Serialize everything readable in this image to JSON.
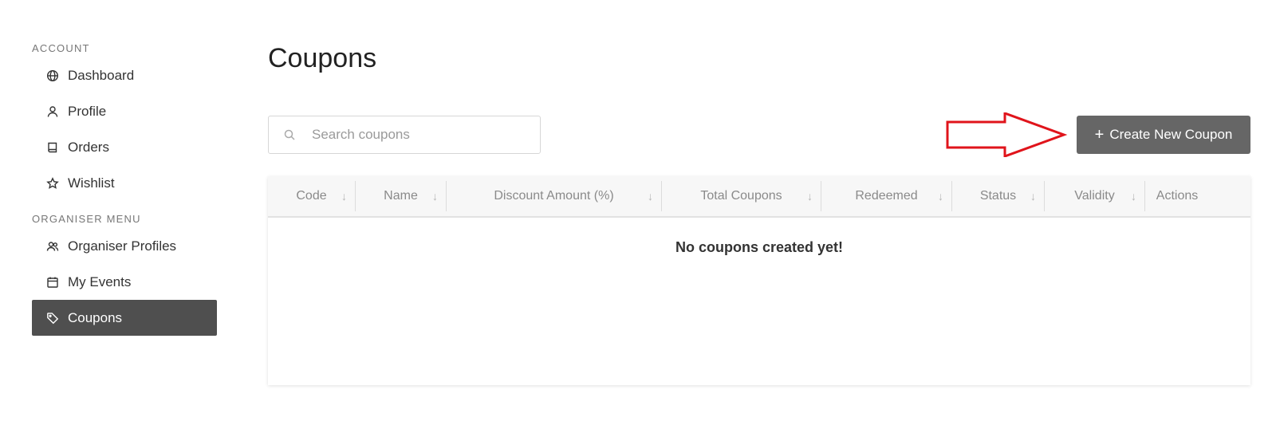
{
  "sidebar": {
    "account_title": "ACCOUNT",
    "account_items": [
      {
        "label": "Dashboard",
        "icon": "globe-icon"
      },
      {
        "label": "Profile",
        "icon": "user-icon"
      },
      {
        "label": "Orders",
        "icon": "book-icon"
      },
      {
        "label": "Wishlist",
        "icon": "star-icon"
      }
    ],
    "organiser_title": "ORGANISER MENU",
    "organiser_items": [
      {
        "label": "Organiser Profiles",
        "icon": "users-icon"
      },
      {
        "label": "My Events",
        "icon": "calendar-icon"
      },
      {
        "label": "Coupons",
        "icon": "tag-icon",
        "active": true
      }
    ]
  },
  "main": {
    "title": "Coupons",
    "search": {
      "placeholder": "Search coupons",
      "value": ""
    },
    "create_button": {
      "plus": "+",
      "label": "Create New Coupon"
    },
    "annotation": {
      "type": "red-arrow",
      "color": "#e0141b"
    },
    "table": {
      "columns": [
        "Code",
        "Name",
        "Discount Amount (%)",
        "Total Coupons",
        "Redeemed",
        "Status",
        "Validity",
        "Actions"
      ],
      "sort_icon": "↓",
      "empty_message": "No coupons created yet!"
    }
  },
  "colors": {
    "active_bg": "#4f4f4f",
    "button_bg": "#666666",
    "header_bg": "#f7f7f7"
  }
}
